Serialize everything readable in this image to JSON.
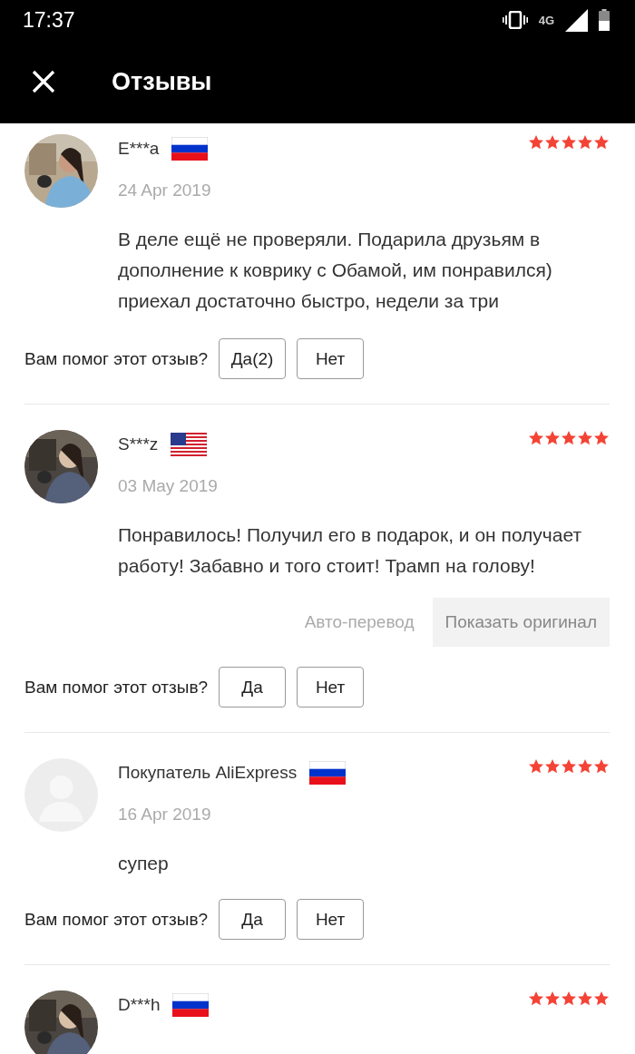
{
  "status_bar": {
    "time": "17:37",
    "network": "4G"
  },
  "app_bar": {
    "title": "Отзывы"
  },
  "reviews": [
    {
      "name": "E***a",
      "flag": {
        "kind": "russia"
      },
      "stars": 5,
      "date": "24 Apr 2019",
      "text": "В деле ещё не проверяли. Подарила друзьям в дополнение к коврику с Обамой, им понравился) приехал достаточно быстро, недели за три",
      "helpful": {
        "question": "Вам помог этот отзыв?",
        "yes": "Да(2)",
        "no": "Нет"
      }
    },
    {
      "name": "S***z",
      "flag": {
        "kind": "usa"
      },
      "stars": 5,
      "date": "03 May 2019",
      "text": "Понравилось! Получил его в подарок, и он получает работу! Забавно и того стоит! Трамп на голову!",
      "translation": {
        "label": "Авто-перевод",
        "button": "Показать оригинал"
      },
      "helpful": {
        "question": "Вам помог этот отзыв?",
        "yes": "Да",
        "no": "Нет"
      }
    },
    {
      "avatar": {
        "kind": "placeholder"
      },
      "name": "Покупатель AliExpress",
      "flag": {
        "kind": "russia"
      },
      "stars": 5,
      "date": "16 Apr 2019",
      "text": "супер",
      "helpful": {
        "question": "Вам помог этот отзыв?",
        "yes": "Да",
        "no": "Нет"
      }
    },
    {
      "name": "D***h",
      "flag": {
        "kind": "russia"
      },
      "stars": 5
    }
  ]
}
